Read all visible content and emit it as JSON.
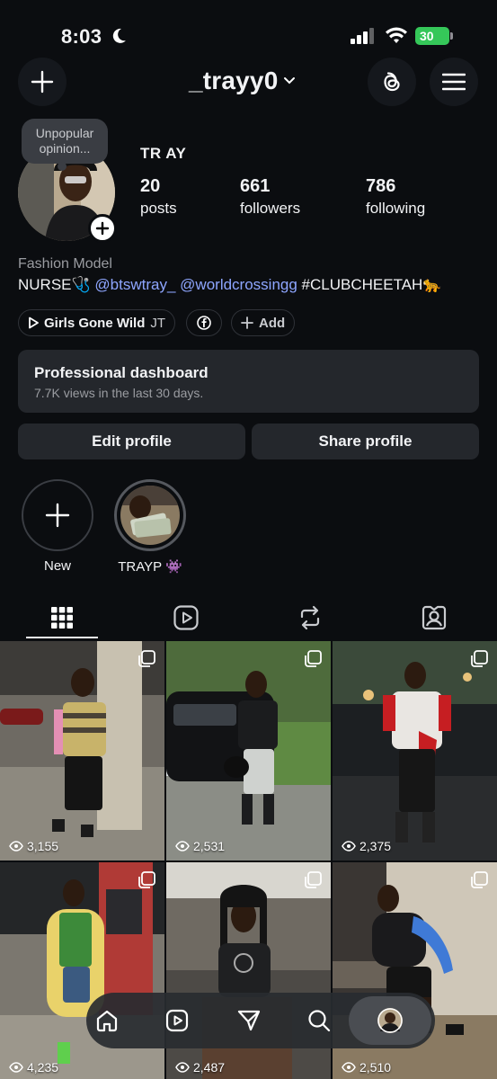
{
  "status_bar": {
    "time": "8:03",
    "battery": "30"
  },
  "header": {
    "username": "_trayy0"
  },
  "profile": {
    "note": "Unpopular opinion...",
    "display_name": "TR AY",
    "stats": [
      {
        "value": "20",
        "label": "posts"
      },
      {
        "value": "661",
        "label": "followers"
      },
      {
        "value": "786",
        "label": "following"
      }
    ],
    "category": "Fashion Model",
    "bio_prefix": "NURSE🩺",
    "mention1": "@btswtray_",
    "mention2": "@worldcrossingg",
    "hashtag": "#CLUBCHEETAH🐆"
  },
  "chips": {
    "music_title": "Girls Gone Wild",
    "music_artist": "JT",
    "add_label": "Add"
  },
  "dashboard": {
    "title": "Professional dashboard",
    "subtitle": "7.7K views in the last 30 days."
  },
  "buttons": {
    "edit": "Edit profile",
    "share": "Share profile"
  },
  "highlights": [
    {
      "label": "New"
    },
    {
      "label": "TRAYP 👾"
    }
  ],
  "posts": [
    {
      "views": "3,155"
    },
    {
      "views": "2,531"
    },
    {
      "views": "2,375"
    },
    {
      "views": "4,235"
    },
    {
      "views": "2,487"
    },
    {
      "views": "2,510"
    }
  ],
  "colors": {
    "background": "#0b0d10",
    "card": "#24272c",
    "mention": "#8ea6ff",
    "battery": "#35c759"
  }
}
